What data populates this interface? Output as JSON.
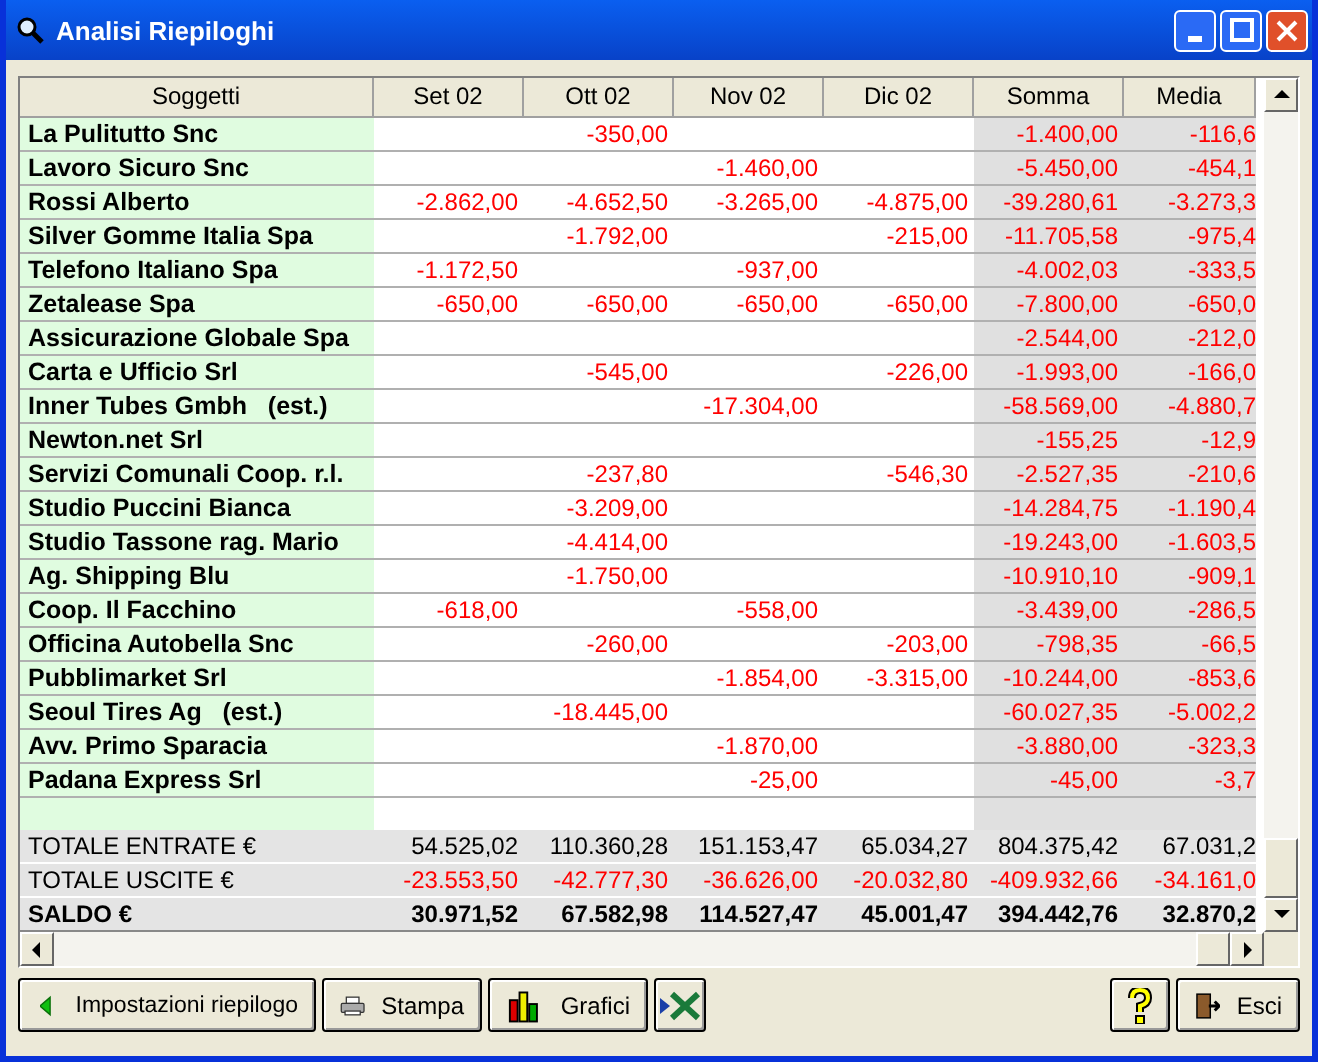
{
  "window": {
    "title": "Analisi Riepiloghi"
  },
  "table": {
    "columns": [
      "Soggetti",
      "Set 02",
      "Ott 02",
      "Nov 02",
      "Dic 02",
      "Somma",
      "Media"
    ],
    "rows": [
      {
        "name": "La Pulitutto Snc",
        "ott": "-350,00",
        "somma": "-1.400,00",
        "media": "-116,6"
      },
      {
        "name": "Lavoro Sicuro Snc",
        "nov": "-1.460,00",
        "somma": "-5.450,00",
        "media": "-454,1"
      },
      {
        "name": "Rossi Alberto",
        "set": "-2.862,00",
        "ott": "-4.652,50",
        "nov": "-3.265,00",
        "dic": "-4.875,00",
        "somma": "-39.280,61",
        "media": "-3.273,3"
      },
      {
        "name": "Silver Gomme Italia Spa",
        "ott": "-1.792,00",
        "dic": "-215,00",
        "somma": "-11.705,58",
        "media": "-975,4"
      },
      {
        "name": "Telefono Italiano Spa",
        "set": "-1.172,50",
        "nov": "-937,00",
        "somma": "-4.002,03",
        "media": "-333,5"
      },
      {
        "name": "Zetalease Spa",
        "set": "-650,00",
        "ott": "-650,00",
        "nov": "-650,00",
        "dic": "-650,00",
        "somma": "-7.800,00",
        "media": "-650,0"
      },
      {
        "name": "Assicurazione Globale Spa",
        "somma": "-2.544,00",
        "media": "-212,0"
      },
      {
        "name": "Carta e Ufficio Srl",
        "ott": "-545,00",
        "dic": "-226,00",
        "somma": "-1.993,00",
        "media": "-166,0"
      },
      {
        "name": "Inner Tubes Gmbh   (est.)",
        "nov": "-17.304,00",
        "somma": "-58.569,00",
        "media": "-4.880,7"
      },
      {
        "name": "Newton.net Srl",
        "somma": "-155,25",
        "media": "-12,9"
      },
      {
        "name": "Servizi Comunali Coop. r.l.",
        "ott": "-237,80",
        "dic": "-546,30",
        "somma": "-2.527,35",
        "media": "-210,6"
      },
      {
        "name": "Studio Puccini Bianca",
        "ott": "-3.209,00",
        "somma": "-14.284,75",
        "media": "-1.190,4"
      },
      {
        "name": "Studio Tassone rag. Mario",
        "ott": "-4.414,00",
        "somma": "-19.243,00",
        "media": "-1.603,5"
      },
      {
        "name": "Ag. Shipping Blu",
        "ott": "-1.750,00",
        "somma": "-10.910,10",
        "media": "-909,1"
      },
      {
        "name": "Coop. Il Facchino",
        "set": "-618,00",
        "nov": "-558,00",
        "somma": "-3.439,00",
        "media": "-286,5"
      },
      {
        "name": "Officina Autobella Snc",
        "ott": "-260,00",
        "dic": "-203,00",
        "somma": "-798,35",
        "media": "-66,5"
      },
      {
        "name": "Pubblimarket Srl",
        "nov": "-1.854,00",
        "dic": "-3.315,00",
        "somma": "-10.244,00",
        "media": "-853,6"
      },
      {
        "name": "Seoul Tires Ag   (est.)",
        "ott": "-18.445,00",
        "somma": "-60.027,35",
        "media": "-5.002,2"
      },
      {
        "name": "Avv. Primo Sparacia",
        "nov": "-1.870,00",
        "somma": "-3.880,00",
        "media": "-323,3"
      },
      {
        "name": "Padana Express Srl",
        "nov": "-25,00",
        "somma": "-45,00",
        "media": "-3,7"
      }
    ],
    "totals": [
      {
        "kind": "entrate",
        "label": "TOTALE ENTRATE €",
        "values": [
          "54.525,02",
          "110.360,28",
          "151.153,47",
          "65.034,27",
          "804.375,42",
          "67.031,2"
        ]
      },
      {
        "kind": "uscite",
        "label": "TOTALE USCITE €",
        "values": [
          "-23.553,50",
          "-42.777,30",
          "-36.626,00",
          "-20.032,80",
          "-409.932,66",
          "-34.161,0"
        ]
      },
      {
        "kind": "saldo",
        "label": "SALDO €",
        "values": [
          "30.971,52",
          "67.582,98",
          "114.527,47",
          "45.001,47",
          "394.442,76",
          "32.870,2"
        ]
      }
    ]
  },
  "buttons": [
    {
      "kind": "back",
      "label": "Impostazioni riepilogo"
    },
    {
      "kind": "print",
      "label": "Stampa"
    },
    {
      "kind": "chart",
      "label": "Grafici"
    },
    {
      "kind": "excel"
    },
    {
      "kind": "help"
    },
    {
      "kind": "exit",
      "label": "Esci"
    }
  ]
}
